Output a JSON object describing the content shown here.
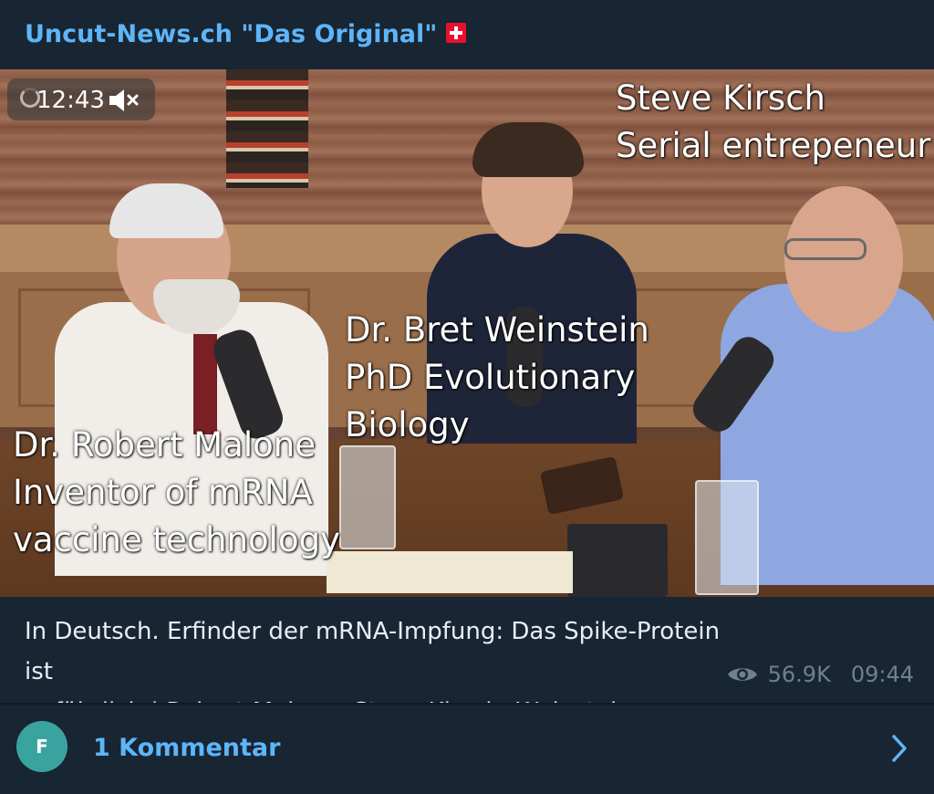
{
  "channel": {
    "title": "Uncut-News.ch \"Das Original\"",
    "flag_icon": "swiss-flag-icon"
  },
  "video": {
    "duration": "12:43",
    "muted": true,
    "captions": {
      "kirsch_name": "Steve Kirsch",
      "kirsch_role": "Serial entrepeneur",
      "weinstein_name": "Dr. Bret Weinstein",
      "weinstein_role1": "PhD Evolutionary",
      "weinstein_role2": "Biology",
      "malone_name": "Dr. Robert Malone",
      "malone_role1": "Inventor of mRNA",
      "malone_role2": "vaccine technology"
    }
  },
  "message": {
    "line1": "In Deutsch. Erfinder der mRNA-Impfung: Das Spike-Protein ist",
    "line2": "gefährlich | Robert Malone, Steve Kirsch, Weinstein",
    "views": "56.9K",
    "time": "09:44"
  },
  "comments": {
    "avatar_letter": "F",
    "label": "1 Kommentar"
  },
  "colors": {
    "accent": "#5eb5f7",
    "background": "#182533",
    "avatar": "#39a3a0",
    "meta": "#6d8192"
  }
}
